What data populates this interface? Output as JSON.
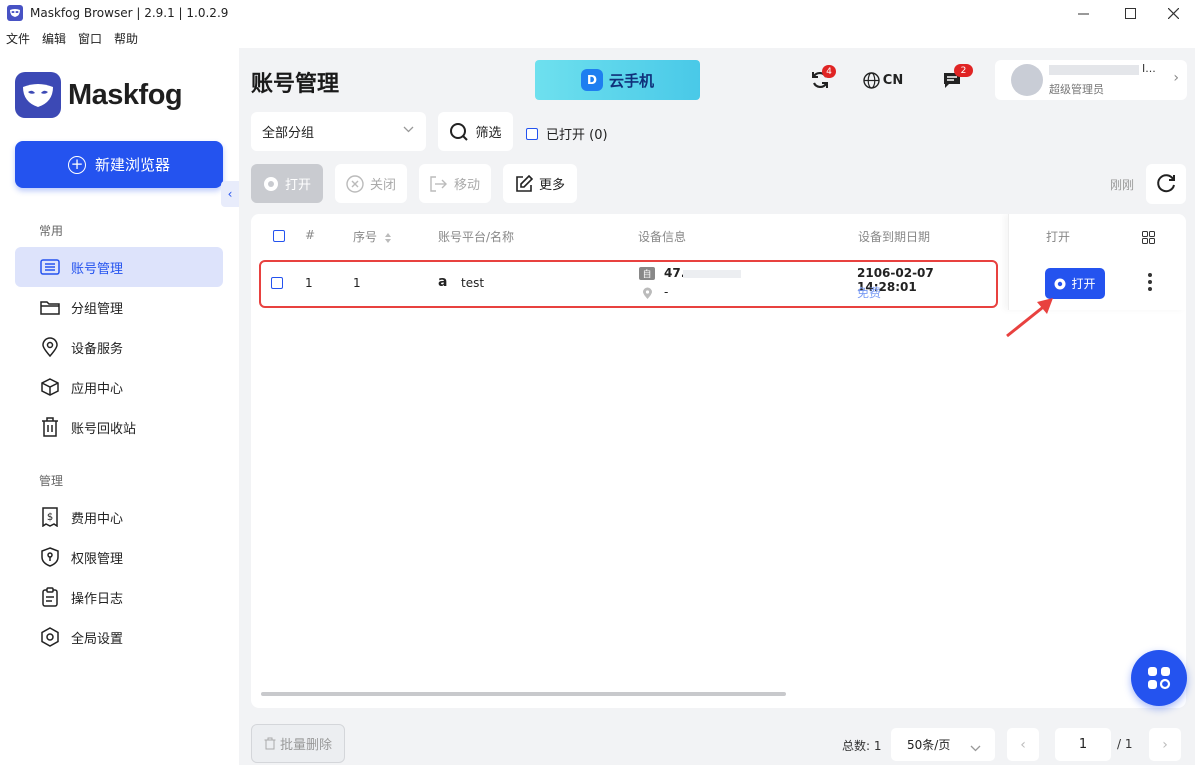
{
  "window": {
    "title": "Maskfog Browser | 2.9.1 | 1.0.2.9",
    "minimize_label": "—",
    "maximize_label": "☐",
    "close_label": "✕"
  },
  "menu": [
    "文件",
    "编辑",
    "窗口",
    "帮助"
  ],
  "sidebar": {
    "brand": "Maskfog",
    "new_browser_label": "新建浏览器",
    "section_common": "常用",
    "section_manage": "管理",
    "items_common": [
      {
        "label": "账号管理",
        "icon": "list-icon",
        "active": true
      },
      {
        "label": "分组管理",
        "icon": "folder-icon"
      },
      {
        "label": "设备服务",
        "icon": "location-pin-icon"
      },
      {
        "label": "应用中心",
        "icon": "cube-icon"
      },
      {
        "label": "账号回收站",
        "icon": "trash-icon"
      }
    ],
    "items_manage": [
      {
        "label": "费用中心",
        "icon": "bill-icon"
      },
      {
        "label": "权限管理",
        "icon": "shield-key-icon"
      },
      {
        "label": "操作日志",
        "icon": "clipboard-icon"
      },
      {
        "label": "全局设置",
        "icon": "settings-hex-icon"
      }
    ]
  },
  "header": {
    "page_title": "账号管理",
    "banner_label": "云手机",
    "sync_badge": "4",
    "language": "CN",
    "messages_badge": "2",
    "user_name_tail": "I...",
    "user_role": "超级管理员"
  },
  "filters": {
    "group_select": "全部分组",
    "filter_label": "筛选",
    "opened_label": "已打开 (0)"
  },
  "toolbar": {
    "open": "打开",
    "close": "关闭",
    "move": "移动",
    "more": "更多",
    "refresh_time": "刚刚"
  },
  "table": {
    "headers": {
      "index": "#",
      "seq": "序号",
      "platform_name": "账号平台/名称",
      "device_info": "设备信息",
      "expiry": "设备到期日期",
      "open": "打开"
    },
    "rows": [
      {
        "index": "1",
        "seq": "1",
        "platform_icon": "amazon-icon",
        "name": "test",
        "device_ip": "47.",
        "device_location": "-",
        "expiry_date": "2106-02-07 14:28:01",
        "plan": "免费",
        "open_label": "打开"
      }
    ]
  },
  "footer": {
    "bulk_delete": "批量删除",
    "total": "总数: 1",
    "page_size": "50条/页",
    "current_page": "1",
    "total_pages": "/ 1"
  },
  "colors": {
    "accent": "#2453ef",
    "highlight_border": "#e8413f",
    "active_nav_bg": "#dde3fb"
  }
}
